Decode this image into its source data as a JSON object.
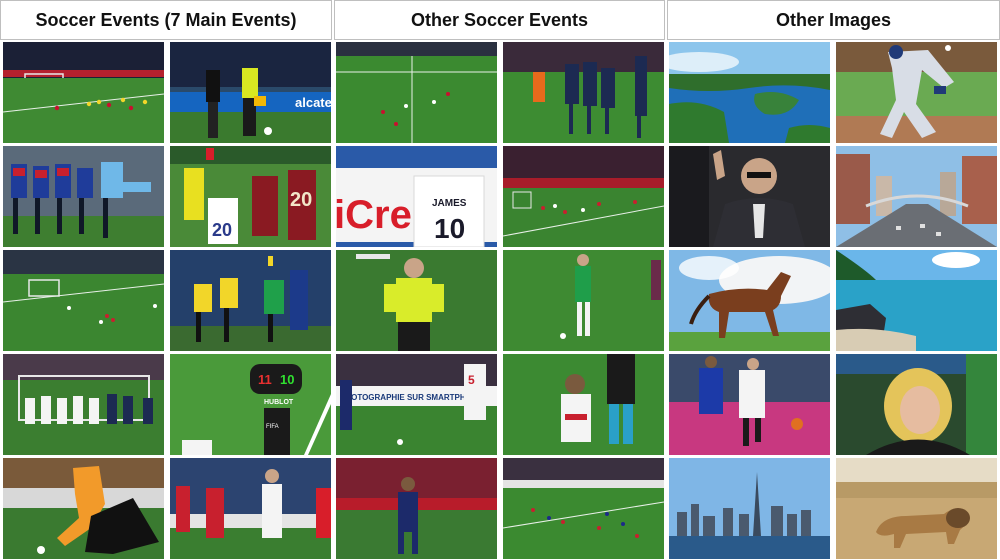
{
  "headers": [
    "Soccer Events (7 Main Events)",
    "Other Soccer Events",
    "Other Images"
  ],
  "tile_text": {
    "ad_board_1": "alcatel",
    "jersey_20": "20",
    "ad_board_icrel": "iCre",
    "jersey_james": "JAMES",
    "jersey_10": "10",
    "sub_board_left": "11",
    "sub_board_right": "10",
    "sub_board_brand": "HUBLOT",
    "ad_board_photo": "PHOTOGRAPHIE SUR SMARTPH",
    "jersey_5": "5",
    "referee_badge": "FIFA"
  }
}
